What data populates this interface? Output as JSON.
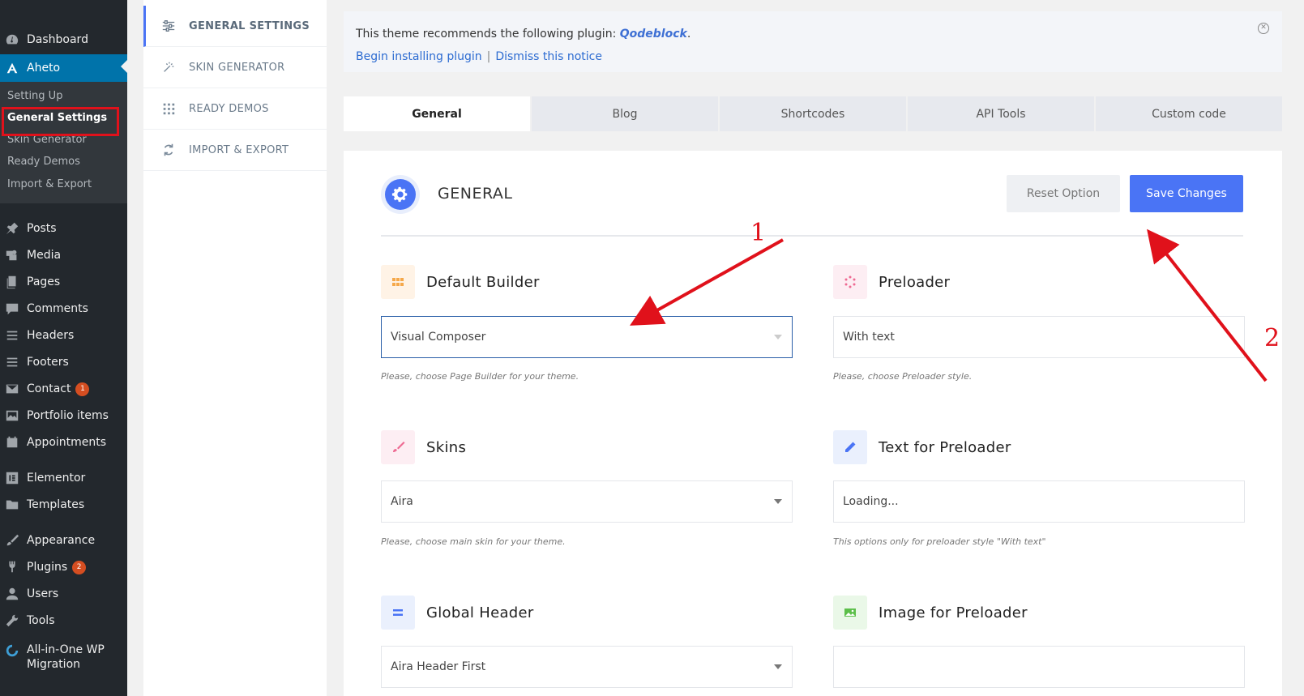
{
  "wp_menu": {
    "items": [
      {
        "label": "Dashboard",
        "icon": "dashboard-icon"
      },
      {
        "label": "Aheto",
        "icon": "aheto-logo-icon"
      },
      {
        "label": "Posts",
        "icon": "pin-icon"
      },
      {
        "label": "Media",
        "icon": "media-icon"
      },
      {
        "label": "Pages",
        "icon": "pages-icon"
      },
      {
        "label": "Comments",
        "icon": "comment-icon"
      },
      {
        "label": "Headers",
        "icon": "list-icon"
      },
      {
        "label": "Footers",
        "icon": "list-icon"
      },
      {
        "label": "Contact",
        "icon": "mail-icon",
        "badge": "1"
      },
      {
        "label": "Portfolio items",
        "icon": "portfolio-icon"
      },
      {
        "label": "Appointments",
        "icon": "calendar-icon"
      },
      {
        "label": "Elementor",
        "icon": "elementor-icon"
      },
      {
        "label": "Templates",
        "icon": "folder-icon"
      },
      {
        "label": "Appearance",
        "icon": "brush-icon"
      },
      {
        "label": "Plugins",
        "icon": "plug-icon",
        "badge": "2"
      },
      {
        "label": "Users",
        "icon": "user-icon"
      },
      {
        "label": "Tools",
        "icon": "wrench-icon"
      },
      {
        "label": "All-in-One WP Migration",
        "icon": "migration-icon"
      }
    ],
    "submenu": [
      "Setting Up",
      "General Settings",
      "Skin Generator",
      "Ready Demos",
      "Import & Export"
    ]
  },
  "aheto_nav": {
    "items": [
      {
        "label": "GENERAL SETTINGS",
        "icon": "sliders-icon"
      },
      {
        "label": "SKIN GENERATOR",
        "icon": "magic-wand-icon"
      },
      {
        "label": "READY DEMOS",
        "icon": "grid-icon"
      },
      {
        "label": "IMPORT & EXPORT",
        "icon": "sync-icon"
      }
    ]
  },
  "notice": {
    "text": "This theme recommends the following plugin: ",
    "plugin": "Qodeblock",
    "period": ".",
    "install_link": "Begin installing plugin",
    "separator": "|",
    "dismiss_link": "Dismiss this notice"
  },
  "tabs": [
    "General",
    "Blog",
    "Shortcodes",
    "API Tools",
    "Custom code"
  ],
  "panel": {
    "title": "GENERAL",
    "reset_label": "Reset Option",
    "save_label": "Save Changes"
  },
  "fields": {
    "default_builder": {
      "label": "Default Builder",
      "value": "Visual Composer",
      "hint": "Please, choose Page Builder for your theme."
    },
    "preloader": {
      "label": "Preloader",
      "value": "With text",
      "hint": "Please, choose Preloader style."
    },
    "skins": {
      "label": "Skins",
      "value": "Aira",
      "hint": "Please, choose main skin for your theme."
    },
    "text_preloader": {
      "label": "Text for Preloader",
      "value": "Loading...",
      "hint": "This options only for preloader style \"With text\""
    },
    "global_header": {
      "label": "Global Header",
      "value": "Aira Header First"
    },
    "image_preloader": {
      "label": "Image for Preloader",
      "value": ""
    }
  },
  "annotations": {
    "one": "1",
    "two": "2"
  },
  "colors": {
    "accent": "#4a74f5",
    "wp_sidebar": "#23282d",
    "wp_active": "#0073aa",
    "annotation": "#e0111b"
  }
}
